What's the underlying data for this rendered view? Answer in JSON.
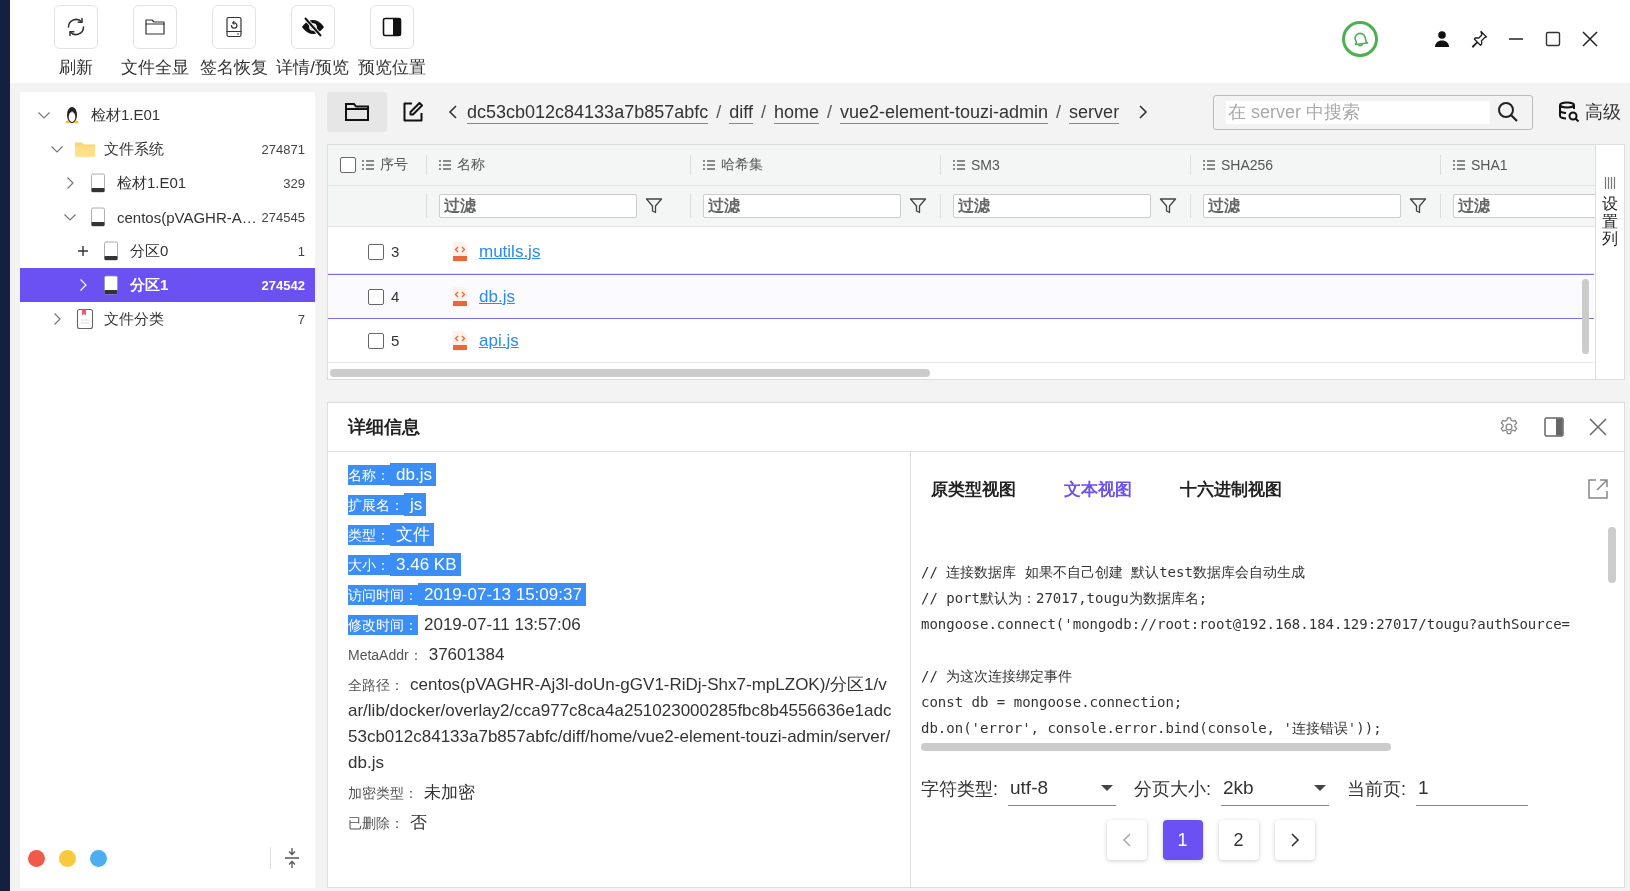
{
  "toolbar": {
    "buttons": [
      {
        "label": "刷新",
        "kind": "refresh"
      },
      {
        "label": "文件全显",
        "kind": "folder"
      },
      {
        "label": "签名恢复",
        "kind": "restore"
      },
      {
        "label": "详情/预览",
        "kind": "hide"
      },
      {
        "label": "预览位置",
        "kind": "panel"
      }
    ]
  },
  "sidebar": {
    "tree": [
      {
        "label": "检材1.E01",
        "kind": "linux",
        "expanded": true,
        "loaded": true,
        "selected": false,
        "children": [
          {
            "label": "文件系统",
            "count": "274871",
            "kind": "folder",
            "expanded": true,
            "loaded": true,
            "selected": false,
            "children": [
              {
                "label": "检材1.E01",
                "count": "329",
                "kind": "disk",
                "expanded": false,
                "loaded": true,
                "selected": false
              },
              {
                "label": "centos(pVAGHR-A…",
                "count": "274545",
                "kind": "disk",
                "expanded": true,
                "loaded": true,
                "selected": false,
                "children": [
                  {
                    "label": "分区0",
                    "count": "1",
                    "kind": "disk",
                    "expanded": false,
                    "loaded": false,
                    "selected": false
                  },
                  {
                    "label": "分区1",
                    "count": "274542",
                    "kind": "disk",
                    "expanded": false,
                    "loaded": true,
                    "selected": true
                  }
                ]
              }
            ]
          },
          {
            "label": "文件分类",
            "count": "7",
            "kind": "doc",
            "expanded": false,
            "loaded": true,
            "selected": false
          }
        ]
      }
    ],
    "dots": [
      {
        "color": "#f15a4a"
      },
      {
        "color": "#f8c93c"
      },
      {
        "color": "#4aaef0"
      }
    ]
  },
  "browser": {
    "crumbs": [
      "dc53cb012c84133a7b857abfc",
      "diff",
      "home",
      "vue2-element-touzi-admin",
      "server"
    ],
    "separators": [
      "/",
      "/",
      "/",
      "/"
    ],
    "search": {
      "placeholder": "在 server 中搜索"
    },
    "advanced_button": "高级",
    "table": {
      "select_all": {
        "checked": false
      },
      "columns": [
        "序号",
        "名称",
        "哈希集",
        "SM3",
        "SHA256",
        "SHA1"
      ],
      "filters": [
        {
          "placeholder": "过滤"
        },
        {
          "placeholder": "过滤"
        },
        {
          "placeholder": "过滤"
        },
        {
          "placeholder": "过滤"
        },
        {
          "placeholder": "过滤"
        }
      ],
      "rows": [
        {
          "index": "3",
          "name": "mutils.js",
          "checked": false,
          "selected": false
        },
        {
          "index": "4",
          "name": "db.js",
          "checked": false,
          "selected": true
        },
        {
          "index": "5",
          "name": "api.js",
          "checked": false,
          "selected": false
        }
      ],
      "column_settings": "设置列"
    }
  },
  "details": {
    "title": "详细信息",
    "fields": [
      {
        "kind": "inline",
        "label": "名称：",
        "value": "db.js",
        "label_selected": true,
        "value_selected": true
      },
      {
        "kind": "inline",
        "label": "扩展名：",
        "value": "js",
        "label_selected": true,
        "value_selected": true
      },
      {
        "kind": "inline",
        "label": "类型：",
        "value": "文件",
        "label_selected": true,
        "value_selected": true
      },
      {
        "kind": "inline",
        "label": "大小：",
        "value": "3.46 KB",
        "label_selected": true,
        "value_selected": true
      },
      {
        "kind": "inline",
        "label": "访问时间：",
        "value": "2019-07-13 15:09:37",
        "label_selected": true,
        "value_selected": true
      },
      {
        "kind": "inline",
        "label": "修改时间：",
        "value": "2019-07-11 13:57:06",
        "label_selected": true,
        "value_selected": false
      },
      {
        "kind": "inline",
        "label": "MetaAddr：",
        "value": "37601384",
        "label_selected": false,
        "value_selected": false
      },
      {
        "kind": "block",
        "label": "全路径：",
        "value": "centos(pVAGHR-Aj3l-doUn-gGV1-RiDj-Shx7-mpLZOK)/分区1/var/lib/docker/overlay2/cca977c8ca4a251023000285fbc8b4556636e1adc53cb012c84133a7b857abfc/diff/home/vue2-element-touzi-admin/server/db.js",
        "label_selected": false,
        "value_selected": false
      },
      {
        "kind": "inline",
        "label": "加密类型：",
        "value": "未加密",
        "label_selected": false,
        "value_selected": false
      },
      {
        "kind": "inline",
        "label": "已删除：",
        "value": "否",
        "label_selected": false,
        "value_selected": false
      }
    ],
    "views": [
      {
        "label": "原类型视图",
        "selected": false
      },
      {
        "label": "文本视图",
        "selected": true
      },
      {
        "label": "十六进制视图",
        "selected": false
      }
    ],
    "code_blocks": [
      [
        "// 连接数据库 如果不自己创建 默认test数据库会自动生成",
        "// port默认为：27017,tougu为数据库名;",
        "mongoose.connect('mongodb://root:root@192.168.184.129:27017/tougu?authSource="
      ],
      [
        "// 为这次连接绑定事件",
        "const db = mongoose.connection;",
        "db.on('error', console.error.bind(console, '连接错误'));"
      ]
    ],
    "charset": {
      "label": "字符类型:",
      "value": "utf-8"
    },
    "page_size": {
      "label": "分页大小:",
      "value": "2kb"
    },
    "current_page": {
      "label": "当前页:",
      "value": "1"
    },
    "pages": [
      {
        "label": "1",
        "selected": true
      },
      {
        "label": "2",
        "selected": false
      }
    ]
  }
}
